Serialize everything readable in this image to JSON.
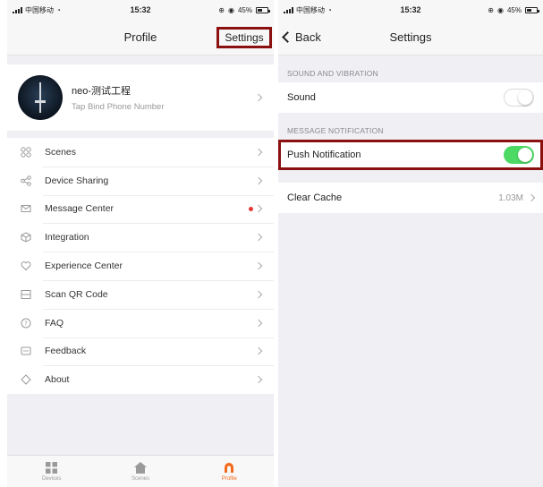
{
  "status": {
    "carrier": "中国移动",
    "time": "15:32",
    "battery": "45%"
  },
  "profile_screen": {
    "title": "Profile",
    "settings_link": "Settings",
    "user": {
      "name": "neo-测试工程",
      "subtitle": "Tap Bind Phone Number"
    },
    "menu": [
      {
        "label": "Scenes",
        "icon": "scenes-icon"
      },
      {
        "label": "Device Sharing",
        "icon": "share-icon"
      },
      {
        "label": "Message Center",
        "icon": "message-icon",
        "badge": true
      },
      {
        "label": "Integration",
        "icon": "integration-icon"
      },
      {
        "label": "Experience Center",
        "icon": "heart-icon"
      },
      {
        "label": "Scan QR Code",
        "icon": "scan-icon"
      },
      {
        "label": "FAQ",
        "icon": "question-icon"
      },
      {
        "label": "Feedback",
        "icon": "feedback-icon"
      },
      {
        "label": "About",
        "icon": "diamond-icon"
      }
    ],
    "tabs": [
      {
        "label": "Devices",
        "icon": "grid-icon"
      },
      {
        "label": "Scenes",
        "icon": "home-icon"
      },
      {
        "label": "Profile",
        "icon": "profile-icon",
        "active": true
      }
    ]
  },
  "settings_screen": {
    "back_label": "Back",
    "title": "Settings",
    "sections": {
      "sound_header": "SOUND AND VIBRATION",
      "sound_label": "Sound",
      "sound_on": false,
      "message_header": "MESSAGE NOTIFICATION",
      "push_label": "Push Notification",
      "push_on": true,
      "clear_cache_label": "Clear Cache",
      "cache_size": "1.03M"
    }
  },
  "colors": {
    "accent": "#f26b1d",
    "toggle_on": "#4cd964",
    "highlight_box": "#8b1010",
    "badge": "#e53935"
  }
}
